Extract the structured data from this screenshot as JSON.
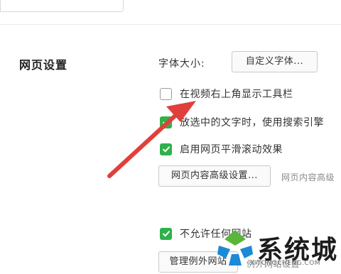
{
  "section": {
    "title": "网页设置"
  },
  "font": {
    "label": "字体大小:",
    "custom_button": "自定义字体..."
  },
  "checkboxes": [
    {
      "label": "在视频右上角显示工具栏",
      "checked": false
    },
    {
      "label": "放选中的文字时，使用搜索引擎",
      "checked": true
    },
    {
      "label": "启用网页平滑滚动效果",
      "checked": true
    },
    {
      "label": "不允许任何网站",
      "checked": true
    }
  ],
  "advanced": {
    "button": "网页内容高级设置...",
    "hint": "网页内容高级"
  },
  "exceptions": {
    "button": "管理例外网站",
    "hint": "例外网站设置"
  },
  "watermark": {
    "text": "系统城",
    "url": "XITONGCHENG.COM"
  },
  "colors": {
    "check_green": "#2fb14a",
    "arrow_red": "#e0403c",
    "logo_blue": "#1b8ad8",
    "logo_green": "#5bb53a"
  }
}
